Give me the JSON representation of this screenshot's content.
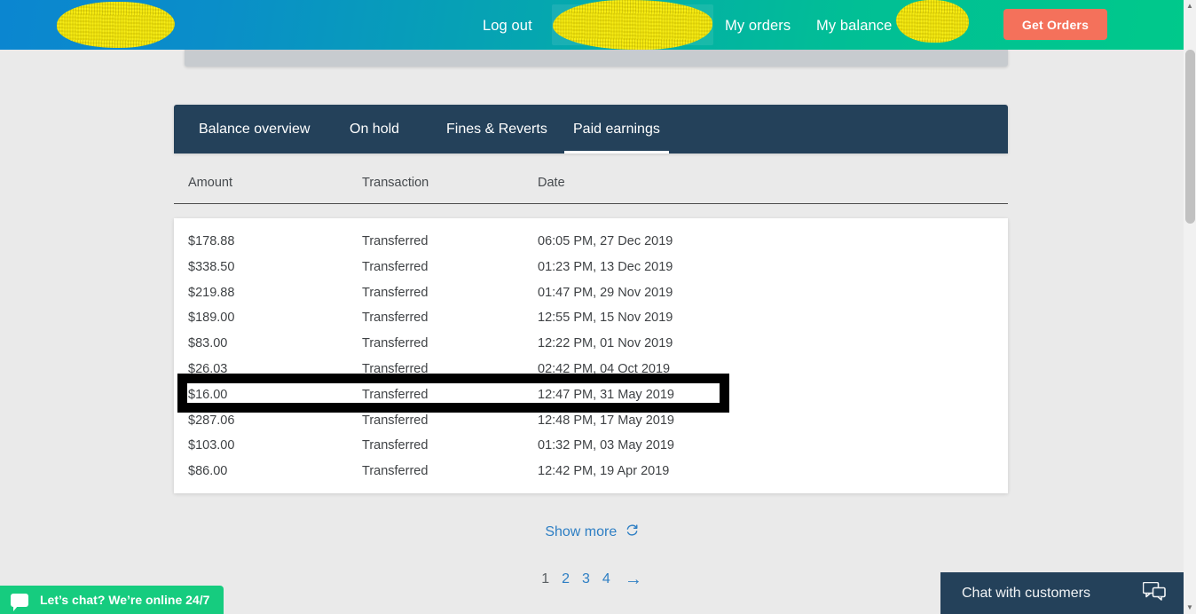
{
  "header": {
    "nav": {
      "logout": "Log out",
      "my_orders": "My orders",
      "my_balance": "My balance"
    },
    "get_orders_button": "Get Orders",
    "gradient_start": "#0b86d0",
    "gradient_end": "#00c98b",
    "button_color": "#f4715b",
    "redaction_color": "#f7ec14"
  },
  "tabs": [
    {
      "label": "Balance overview",
      "active": false
    },
    {
      "label": "On hold",
      "active": false
    },
    {
      "label": "Fines & Reverts",
      "active": false
    },
    {
      "label": "Paid earnings",
      "active": true
    }
  ],
  "table": {
    "columns": [
      "Amount",
      "Transaction",
      "Date"
    ],
    "rows": [
      {
        "amount": "$178.88",
        "transaction": "Transferred",
        "date": "06:05 PM, 27 Dec 2019",
        "highlighted": false
      },
      {
        "amount": "$338.50",
        "transaction": "Transferred",
        "date": "01:23 PM, 13 Dec 2019",
        "highlighted": false
      },
      {
        "amount": "$219.88",
        "transaction": "Transferred",
        "date": "01:47 PM, 29 Nov 2019",
        "highlighted": false
      },
      {
        "amount": "$189.00",
        "transaction": "Transferred",
        "date": "12:55 PM, 15 Nov 2019",
        "highlighted": false
      },
      {
        "amount": "$83.00",
        "transaction": "Transferred",
        "date": "12:22 PM, 01 Nov 2019",
        "highlighted": false
      },
      {
        "amount": "$26.03",
        "transaction": "Transferred",
        "date": "02:42 PM, 04 Oct 2019",
        "highlighted": false
      },
      {
        "amount": "$16.00",
        "transaction": "Transferred",
        "date": "12:47 PM, 31 May 2019",
        "highlighted": true
      },
      {
        "amount": "$287.06",
        "transaction": "Transferred",
        "date": "12:48 PM, 17 May 2019",
        "highlighted": false
      },
      {
        "amount": "$103.00",
        "transaction": "Transferred",
        "date": "01:32 PM, 03 May 2019",
        "highlighted": false
      },
      {
        "amount": "$86.00",
        "transaction": "Transferred",
        "date": "12:42 PM, 19 Apr 2019",
        "highlighted": false
      }
    ]
  },
  "show_more": {
    "label": "Show more",
    "icon": "refresh-icon"
  },
  "pagination": {
    "pages": [
      {
        "label": "1",
        "current": true
      },
      {
        "label": "2",
        "current": false
      },
      {
        "label": "3",
        "current": false
      },
      {
        "label": "4",
        "current": false
      }
    ],
    "next_arrow": "→",
    "link_color": "#2e7fc4"
  },
  "live_chat": {
    "label": "Let’s chat? We’re online 24/7",
    "background": "#16cc7f"
  },
  "customer_chat": {
    "label": "Chat with customers",
    "background": "#24415a"
  }
}
